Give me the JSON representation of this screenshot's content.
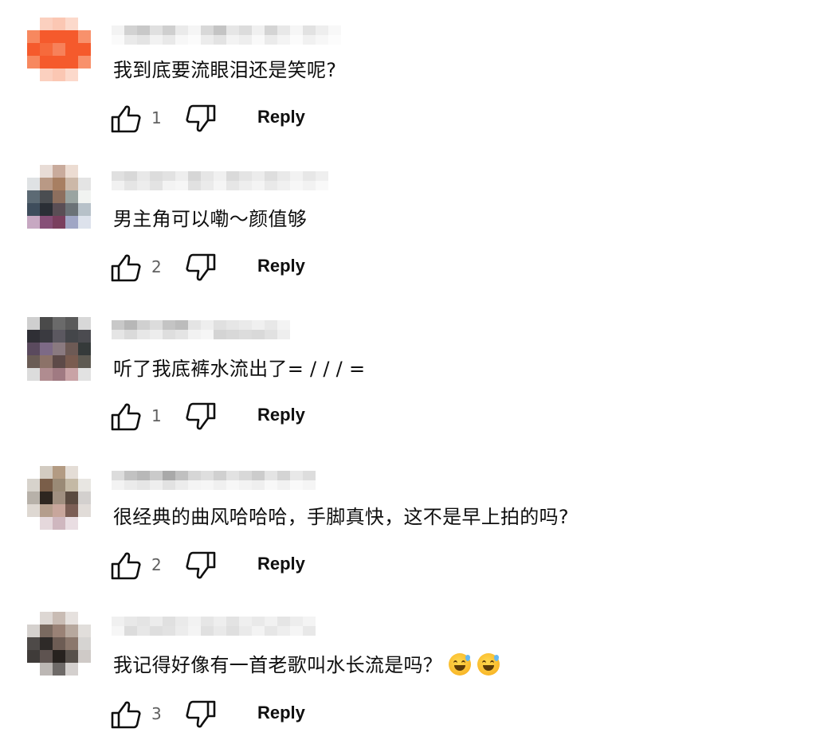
{
  "comments": [
    {
      "text": "我到底要流眼泪还是笑呢?",
      "likes": "1",
      "reply_label": "Reply",
      "emoji_count": 0
    },
    {
      "text": "男主角可以嘞～颜值够",
      "likes": "2",
      "reply_label": "Reply",
      "emoji_count": 0
    },
    {
      "text": "听了我底裤水流出了= / / / =",
      "likes": "1",
      "reply_label": "Reply",
      "emoji_count": 0
    },
    {
      "text": "很经典的曲风哈哈哈，手脚真快，这不是早上拍的吗?",
      "likes": "2",
      "reply_label": "Reply",
      "emoji_count": 0
    },
    {
      "text": "我记得好像有一首老歌叫水长流是吗？",
      "likes": "3",
      "reply_label": "Reply",
      "emoji_count": 2
    }
  ],
  "icons": {
    "like": "thumbs-up-icon",
    "dislike": "thumbs-down-icon"
  },
  "colors": {
    "text": "#0f0f0f",
    "count": "#606060",
    "avatar_1": "#f55a2c"
  }
}
